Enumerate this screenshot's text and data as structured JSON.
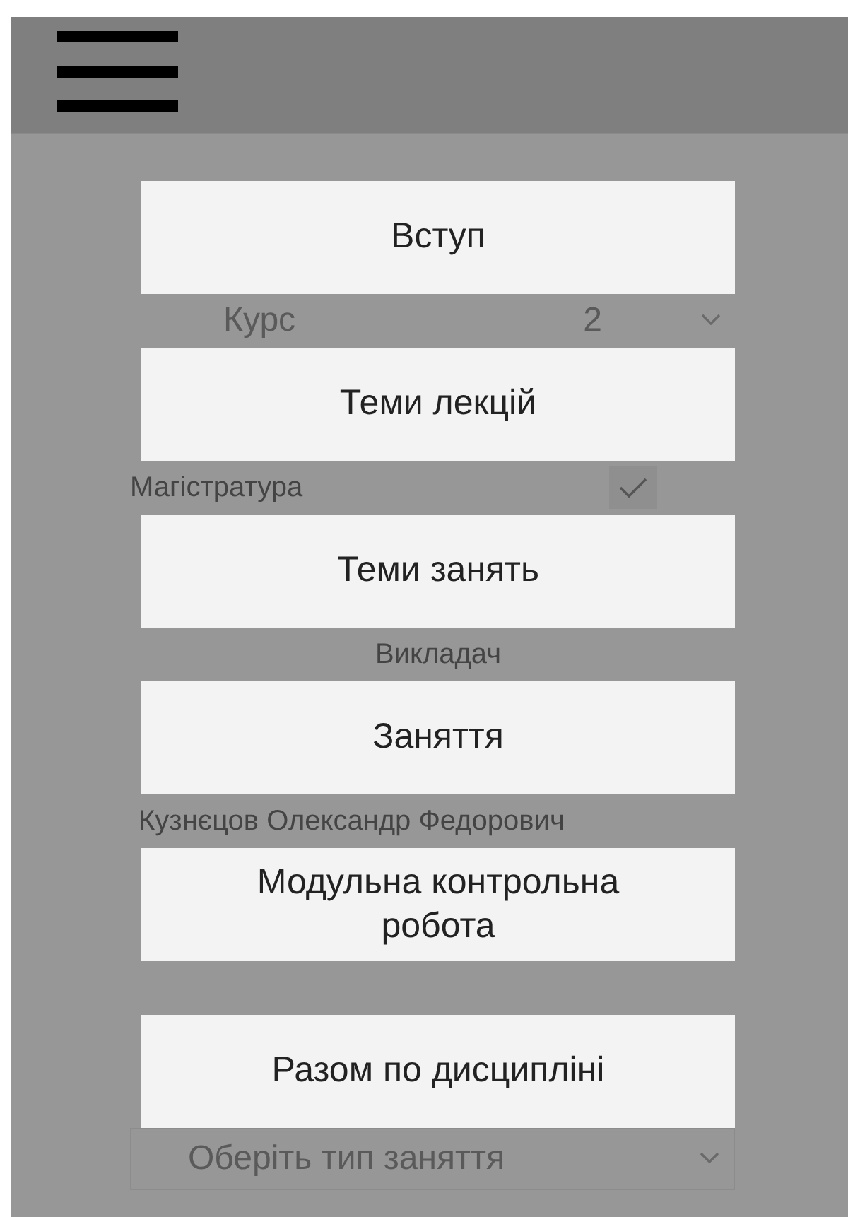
{
  "form": {
    "course_label": "Курс",
    "course_value": "2",
    "masters": {
      "label": "Магістратура",
      "checked": true
    },
    "teacher_label": "Викладач",
    "teacher_name": "Кузнєцов Олександр Федорович",
    "lesson_type": {
      "placeholder": "Оберіть тип заняття"
    }
  },
  "menu_items": [
    "Вступ",
    "Теми лекцій",
    "Теми занять",
    "Заняття",
    "Модульна контрольна робота",
    "Разом по дисципліні"
  ]
}
